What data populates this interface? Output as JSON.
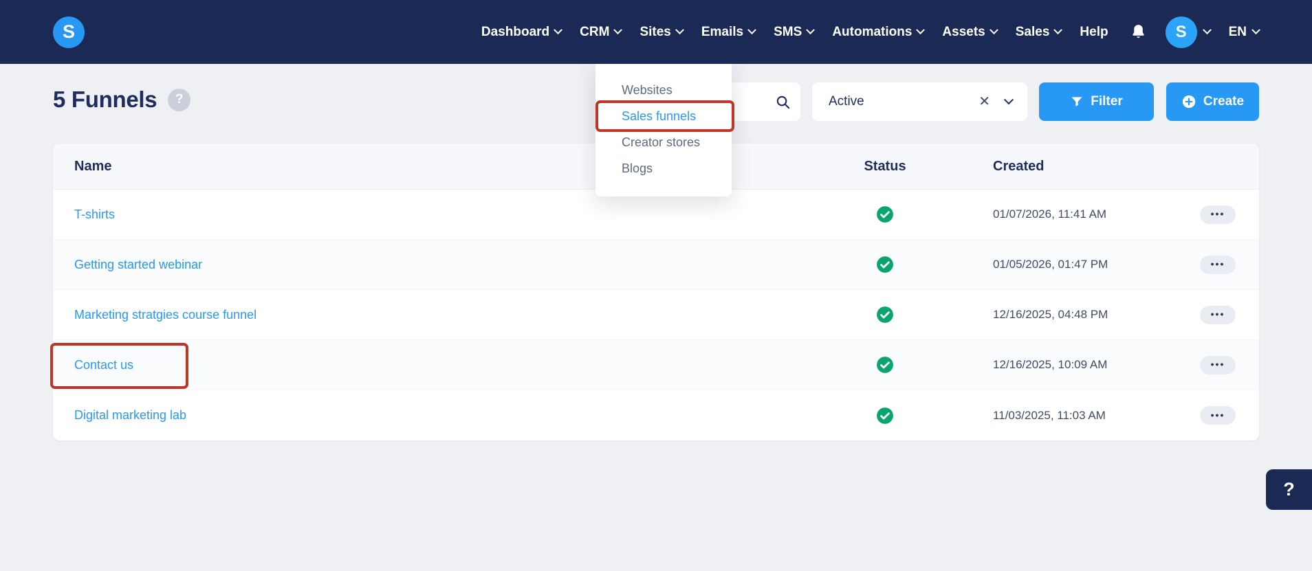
{
  "colors": {
    "navbar_navy": "#1b2a55",
    "accent_blue": "#2898f5",
    "link_blue": "#2898f5",
    "status_green": "#0aa56e",
    "annotation_red": "#c13428"
  },
  "nav": {
    "logo_letter": "S",
    "items": [
      {
        "label": "Dashboard",
        "chevron": true
      },
      {
        "label": "CRM",
        "chevron": true
      },
      {
        "label": "Sites",
        "chevron": true
      },
      {
        "label": "Emails",
        "chevron": true
      },
      {
        "label": "SMS",
        "chevron": true
      },
      {
        "label": "Automations",
        "chevron": true
      },
      {
        "label": "Assets",
        "chevron": true
      },
      {
        "label": "Sales",
        "chevron": true
      },
      {
        "label": "Help",
        "chevron": false
      }
    ],
    "avatar_letter": "S",
    "language": "EN"
  },
  "page": {
    "title": "5 Funnels",
    "help_badge": "?"
  },
  "sites_menu": {
    "items": [
      "Websites",
      "Sales funnels",
      "Creator stores",
      "Blogs"
    ],
    "highlighted": "Sales funnels"
  },
  "filters": {
    "status_value": "Active",
    "clear_icon": "✕",
    "filter_button": "Filter",
    "create_button": "Create"
  },
  "table": {
    "columns": [
      "Name",
      "Status",
      "Created"
    ],
    "rows": [
      {
        "name": "T-shirts",
        "status": "active",
        "created": "01/07/2026, 11:41 AM"
      },
      {
        "name": "Getting started webinar",
        "status": "active",
        "created": "01/05/2026, 01:47 PM"
      },
      {
        "name": "Marketing stratgies course funnel",
        "status": "active",
        "created": "12/16/2025, 04:48 PM"
      },
      {
        "name": "Contact us",
        "status": "active",
        "created": "12/16/2025, 10:09 AM",
        "annotated": true
      },
      {
        "name": "Digital marketing lab",
        "status": "active",
        "created": "11/03/2025, 11:03 AM"
      }
    ],
    "actions_label": "•••"
  },
  "floating_help": "?"
}
